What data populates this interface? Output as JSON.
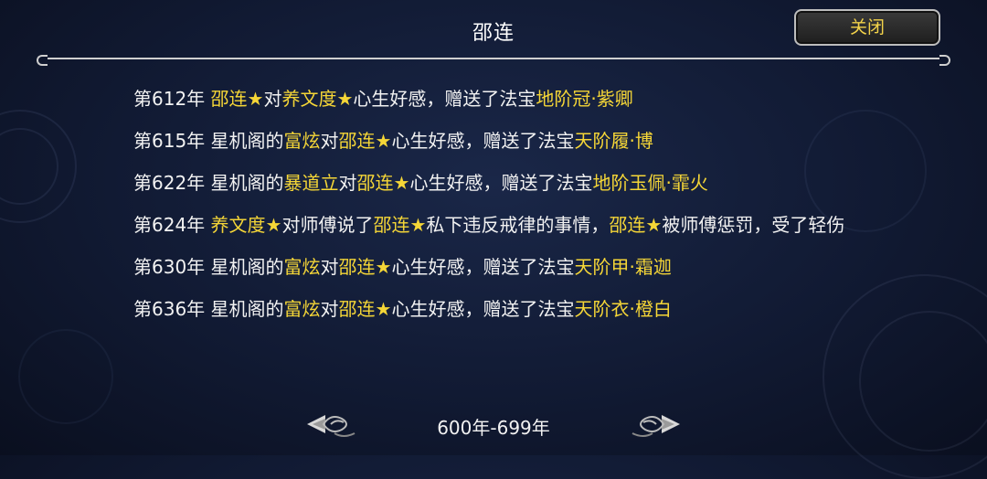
{
  "title": "邵连",
  "close_button": "关闭",
  "events": [
    [
      {
        "t": "第612年 "
      },
      {
        "t": "邵连",
        "h": true
      },
      {
        "t": "★",
        "h": true
      },
      {
        "t": "对"
      },
      {
        "t": "养文度",
        "h": true
      },
      {
        "t": "★",
        "h": true
      },
      {
        "t": "心生好感，赠送了法宝"
      },
      {
        "t": "地阶冠·紫卿",
        "h": true
      }
    ],
    [
      {
        "t": "第615年 星机阁的"
      },
      {
        "t": "富炫",
        "h": true
      },
      {
        "t": "对"
      },
      {
        "t": "邵连",
        "h": true
      },
      {
        "t": "★",
        "h": true
      },
      {
        "t": "心生好感，赠送了法宝"
      },
      {
        "t": "天阶履·博",
        "h": true
      }
    ],
    [
      {
        "t": "第622年 星机阁的"
      },
      {
        "t": "暴道立",
        "h": true
      },
      {
        "t": "对"
      },
      {
        "t": "邵连",
        "h": true
      },
      {
        "t": "★",
        "h": true
      },
      {
        "t": "心生好感，赠送了法宝"
      },
      {
        "t": "地阶玉佩·霏火",
        "h": true
      }
    ],
    [
      {
        "t": "第624年 "
      },
      {
        "t": "养文度",
        "h": true
      },
      {
        "t": "★",
        "h": true
      },
      {
        "t": "对师傅说了"
      },
      {
        "t": "邵连",
        "h": true
      },
      {
        "t": "★",
        "h": true
      },
      {
        "t": "私下违反戒律的事情，"
      },
      {
        "t": "邵连",
        "h": true
      },
      {
        "t": "★",
        "h": true
      },
      {
        "t": "被师傅惩罚，受了轻伤"
      }
    ],
    [
      {
        "t": "第630年 星机阁的"
      },
      {
        "t": "富炫",
        "h": true
      },
      {
        "t": "对"
      },
      {
        "t": "邵连",
        "h": true
      },
      {
        "t": "★",
        "h": true
      },
      {
        "t": "心生好感，赠送了法宝"
      },
      {
        "t": "天阶甲·霜迦",
        "h": true
      }
    ],
    [
      {
        "t": "第636年 星机阁的"
      },
      {
        "t": "富炫",
        "h": true
      },
      {
        "t": "对"
      },
      {
        "t": "邵连",
        "h": true
      },
      {
        "t": "★",
        "h": true
      },
      {
        "t": "心生好感，赠送了法宝"
      },
      {
        "t": "天阶衣·橙白",
        "h": true
      }
    ]
  ],
  "period": "600年-699年",
  "icons": {
    "prev": "prev-page-arrow-icon",
    "next": "next-page-arrow-icon"
  },
  "colors": {
    "highlight": "#f5d637",
    "text": "#f2f2f2",
    "background": "#111a33"
  }
}
